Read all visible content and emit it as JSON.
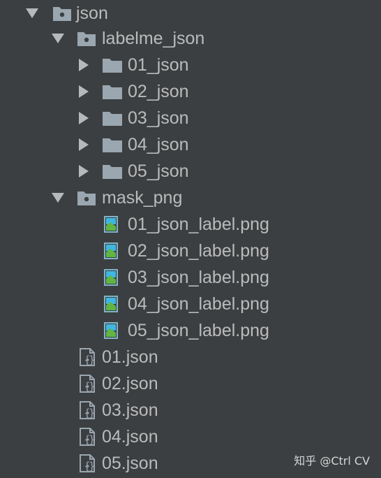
{
  "tree": {
    "root": {
      "label": "json",
      "icon": "package-folder-icon"
    },
    "labelme_json": {
      "label": "labelme_json",
      "icon": "package-folder-icon",
      "children": [
        {
          "label": "01_json",
          "icon": "folder-icon"
        },
        {
          "label": "02_json",
          "icon": "folder-icon"
        },
        {
          "label": "03_json",
          "icon": "folder-icon"
        },
        {
          "label": "04_json",
          "icon": "folder-icon"
        },
        {
          "label": "05_json",
          "icon": "folder-icon"
        }
      ]
    },
    "mask_png": {
      "label": "mask_png",
      "icon": "package-folder-icon",
      "children": [
        {
          "label": "01_json_label.png",
          "icon": "image-file-icon"
        },
        {
          "label": "02_json_label.png",
          "icon": "image-file-icon"
        },
        {
          "label": "03_json_label.png",
          "icon": "image-file-icon"
        },
        {
          "label": "04_json_label.png",
          "icon": "image-file-icon"
        },
        {
          "label": "05_json_label.png",
          "icon": "image-file-icon"
        }
      ]
    },
    "json_files": [
      {
        "label": "01.json",
        "icon": "json-file-icon"
      },
      {
        "label": "02.json",
        "icon": "json-file-icon"
      },
      {
        "label": "03.json",
        "icon": "json-file-icon"
      },
      {
        "label": "04.json",
        "icon": "json-file-icon"
      },
      {
        "label": "05.json",
        "icon": "json-file-icon"
      }
    ]
  },
  "watermark": {
    "text": "知乎 @Ctrl CV"
  },
  "colors": {
    "background": "#3c3f41",
    "text": "#bbbbbb",
    "arrow": "#b6b9bb",
    "folder": "#9aa7b0",
    "image_frame": "#7eb4c7",
    "image_sky": "#40b6e0",
    "image_land": "#62b543",
    "json_file": "#9aa7b0"
  }
}
